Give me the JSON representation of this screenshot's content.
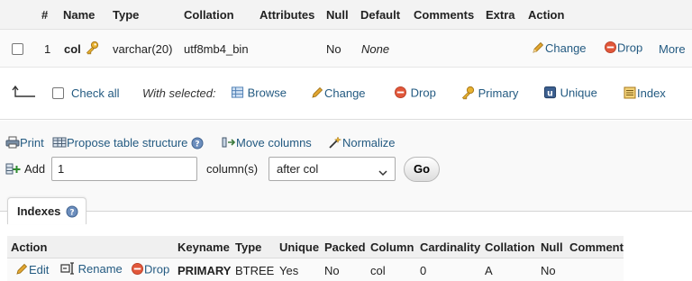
{
  "structure": {
    "columns": [
      "#",
      "Name",
      "Type",
      "Collation",
      "Attributes",
      "Null",
      "Default",
      "Comments",
      "Extra",
      "Action"
    ],
    "row": {
      "num": "1",
      "name": "col",
      "type": "varchar(20)",
      "collation": "utf8mb4_bin",
      "attributes": "",
      "null": "No",
      "default": "None",
      "comments": "",
      "extra": "",
      "actions": {
        "change": "Change",
        "drop": "Drop",
        "more": "More"
      }
    }
  },
  "bulk": {
    "check_all": "Check all",
    "with_selected": "With selected:",
    "browse": "Browse",
    "change": "Change",
    "drop": "Drop",
    "primary": "Primary",
    "unique": "Unique",
    "index": "Index"
  },
  "tools": {
    "print": "Print",
    "propose": "Propose table structure",
    "move_columns": "Move columns",
    "normalize": "Normalize"
  },
  "add_field": {
    "label": "Add",
    "count": "1",
    "unit": "column(s)",
    "position": "after col",
    "go": "Go"
  },
  "indexes": {
    "tab_label": "Indexes",
    "columns": [
      "Action",
      "Keyname",
      "Type",
      "Unique",
      "Packed",
      "Column",
      "Cardinality",
      "Collation",
      "Null",
      "Comment"
    ],
    "row": {
      "edit": "Edit",
      "rename": "Rename",
      "drop": "Drop",
      "keyname": "PRIMARY",
      "type": "BTREE",
      "unique": "Yes",
      "packed": "No",
      "column": "col",
      "cardinality": "0",
      "collation": "A",
      "null": "No",
      "comment": ""
    }
  },
  "colors": {
    "link": "#235a81",
    "drop_icon": "#e1573a",
    "pencil": "#e2a631",
    "key": "#e8b230",
    "header_bg": "#f3f3f3"
  }
}
